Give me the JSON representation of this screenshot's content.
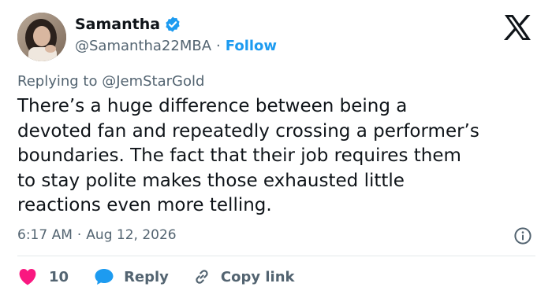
{
  "author": {
    "name": "Samantha",
    "handle": "@Samantha22MBA",
    "separator": "·",
    "follow_label": "Follow",
    "verified_color": "#1d9bf0"
  },
  "brand": {
    "icon": "x-logo-icon"
  },
  "reply_context": {
    "prefix": "Replying to",
    "mention": "@JemStarGold"
  },
  "tweet": {
    "lines": [
      "There’s a huge difference between being a",
      "devoted fan and repeatedly crossing a performer’s",
      "boundaries. The fact that their job requires them",
      "to stay polite makes those exhausted little",
      "reactions even more telling."
    ],
    "time": "6:17 AM",
    "separator": "·",
    "date": "Aug 12, 2026"
  },
  "actions": {
    "like_count": "10",
    "like_color": "#f91880",
    "reply_label": "Reply",
    "reply_color": "#1d9bf0",
    "copy_label": "Copy link",
    "copy_color": "#536471"
  }
}
